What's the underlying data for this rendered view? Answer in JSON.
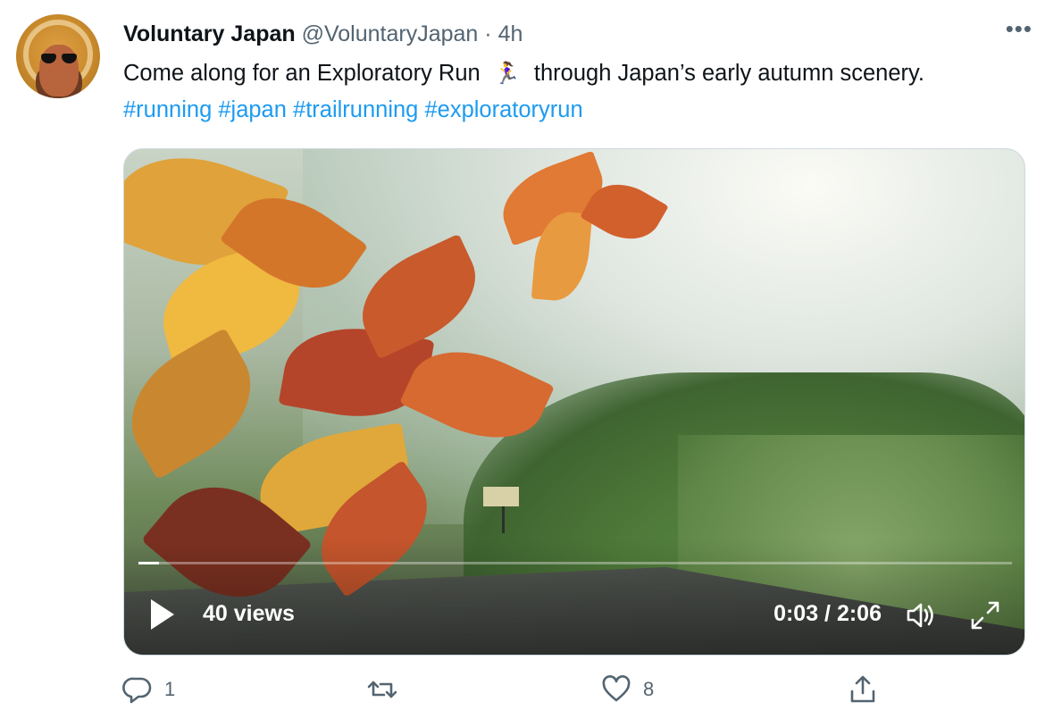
{
  "tweet": {
    "author_name": "Voluntary Japan",
    "handle": "@VoluntaryJapan",
    "separator": "·",
    "time": "4h",
    "more_label": "•••",
    "text_before": "Come along for an Exploratory Run",
    "emoji": "🏃‍♀️",
    "text_after": "through Japan’s early autumn scenery.",
    "hashtags": [
      "#running",
      "#japan",
      "#trailrunning",
      "#exploratoryrun"
    ]
  },
  "video": {
    "views": "40 views",
    "timecode": "0:03 / 2:06",
    "progress_fraction": 0.024,
    "play_icon": "play-icon",
    "volume_icon": "volume-icon",
    "fullscreen_icon": "fullscreen-icon"
  },
  "actions": {
    "reply_count": "1",
    "retweet_count": "",
    "like_count": "8",
    "share_count": ""
  }
}
